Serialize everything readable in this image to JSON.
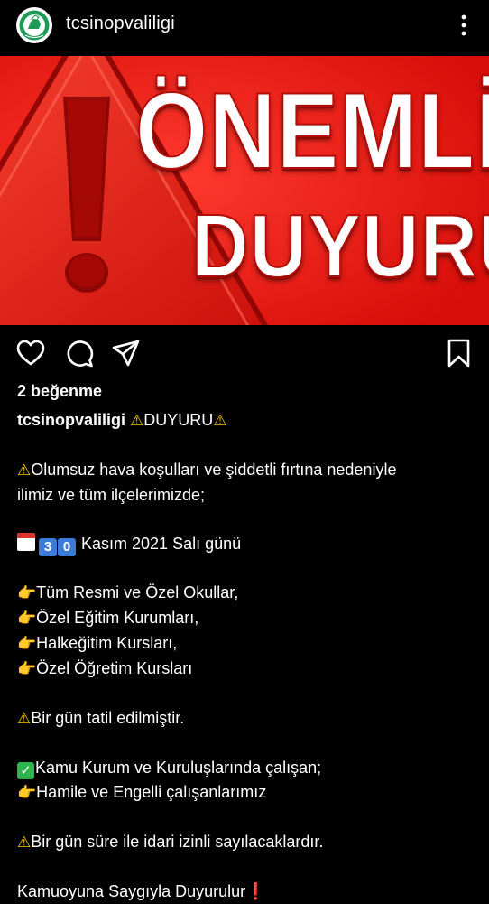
{
  "post": {
    "username": "tcsinopvaliligi",
    "likes": "2 beğenme"
  },
  "banner": {
    "line1": "ÖNEMLİ",
    "line2": "DUYURU"
  },
  "caption": {
    "user": "tcsinopvaliligi",
    "title": "DUYURU",
    "l1": "Olumsuz hava koşulları ve şiddetli fırtına nedeniyle",
    "l2": "ilimiz ve tüm ilçelerimizde;",
    "date_digit_1": "3",
    "date_digit_2": "0",
    "date_text": "Kasım 2021 Salı günü",
    "item1": "Tüm Resmi ve Özel Okullar,",
    "item2": "Özel Eğitim Kurumları,",
    "item3": "Halkeğitim Kursları,",
    "item4": "Özel Öğretim Kursları",
    "notice1": "Bir gün tatil edilmiştir.",
    "l_kamu": "Kamu Kurum ve Kuruluşlarında çalışan;",
    "l_hamile": "Hamile ve Engelli çalışanlarımız",
    "notice2": "Bir gün süre ile idari izinli sayılacaklardır.",
    "closing": "Kamuoyuna Saygıyla Duyurulur"
  },
  "icons": {
    "header": [
      "avatar",
      "more-options-icon"
    ],
    "actions": [
      "heart-icon",
      "comment-icon",
      "share-icon",
      "bookmark-icon"
    ],
    "emoji": [
      "warning-icon",
      "calendar-icon",
      "pointing-hand-icon",
      "check-icon",
      "exclamation-icon"
    ]
  },
  "colors": {
    "background": "#000000",
    "banner_red": "#f4140f",
    "text": "#ffffff",
    "warning": "#f7c200",
    "check": "#2fb550",
    "digit": "#3d7bd8"
  }
}
